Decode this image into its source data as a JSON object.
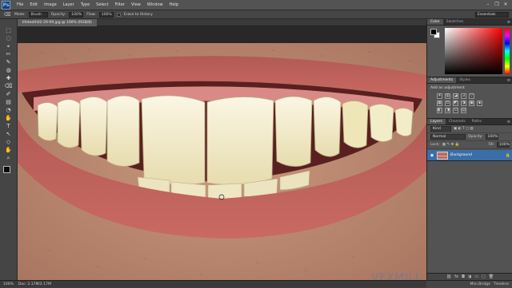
{
  "app": {
    "logo": "Ps"
  },
  "menu": [
    "File",
    "Edit",
    "Image",
    "Layer",
    "Type",
    "Select",
    "Filter",
    "View",
    "Window",
    "Help"
  ],
  "window_controls": [
    "–",
    "❐",
    "✕"
  ],
  "options": {
    "mode_label": "Mode:",
    "mode_value": "Brush",
    "opacity_label": "Opacity:",
    "opacity_value": "100%",
    "flow_label": "Flow:",
    "flow_value": "100%",
    "history_label": "Erase to History",
    "workspace": "Essentials"
  },
  "document": {
    "tab_title": "lifeteeth02-29-09.jpg @ 100% (RGB/8)",
    "watermark": "VFXMILL"
  },
  "status": {
    "zoom": "100%",
    "doc_size": "Doc: 2.17M/2.17M"
  },
  "mini_bridge": {
    "labels": [
      "Mini Bridge",
      "Timeline"
    ]
  },
  "panels": {
    "color": {
      "tabs": [
        "Color",
        "Swatches"
      ]
    },
    "adjustments": {
      "tabs": [
        "Adjustments",
        "Styles"
      ],
      "title": "Add an adjustment",
      "row1": [
        "☀",
        "▥",
        "◪",
        "⊿",
        "▽"
      ],
      "row2": [
        "▦",
        "⚖",
        "◩",
        "◑",
        "▣",
        "◈"
      ],
      "row3": [
        "◧",
        "◨",
        "⊡",
        "▤"
      ]
    },
    "layers": {
      "tabs": [
        "Layers",
        "Channels",
        "Paths"
      ],
      "filter_label": "Kind",
      "blend_mode": "Normal",
      "opacity_label": "Opacity:",
      "opacity_value": "100%",
      "lock_label": "Lock:",
      "fill_label": "Fill:",
      "fill_value": "100%",
      "layer_name": "Background"
    }
  },
  "tools": [
    "⬚",
    "◌",
    "⌖",
    "✂",
    "✎",
    "◍",
    "✚",
    "⌫",
    "✐",
    "▤",
    "◔",
    "✋",
    "T",
    "↖",
    "◇",
    "✋",
    "⌕"
  ]
}
